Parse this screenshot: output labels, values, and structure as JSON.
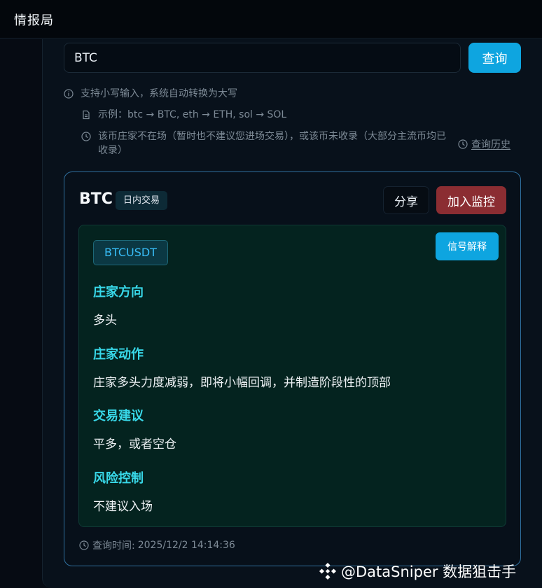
{
  "header": {
    "title": "情报局"
  },
  "search": {
    "value": "BTC",
    "button_label": "查询"
  },
  "hints": {
    "uppercase": "支持小写输入，系统自动转换为大写",
    "example": "示例：btc → BTC, eth → ETH, sol → SOL",
    "absent": "该币庄家不在场（暂时也不建议您进场交易），或该币未收录（大部分主流币均已收录）",
    "history_label": "查询历史"
  },
  "result": {
    "symbol": "BTC",
    "tag": "日内交易",
    "share_label": "分享",
    "monitor_label": "加入监控",
    "pair": "BTCUSDT",
    "explain_label": "信号解释",
    "sections": [
      {
        "title": "庄家方向",
        "text": "多头"
      },
      {
        "title": "庄家动作",
        "text": "庄家多头力度减弱，即将小幅回调，并制造阶段性的顶部"
      },
      {
        "title": "交易建议",
        "text": "平多，或者空仓"
      },
      {
        "title": "风险控制",
        "text": "不建议入场"
      }
    ],
    "query_time_label": "查询时间:",
    "query_time": "2025/12/2 14:14:36"
  },
  "watermark": {
    "text": "@DataSniper 数据狙击手"
  },
  "colors": {
    "accent": "#0ea5e0",
    "monitor": "#8b2d32",
    "section_title": "#38d8e8",
    "pair_text": "#38bdf8"
  }
}
